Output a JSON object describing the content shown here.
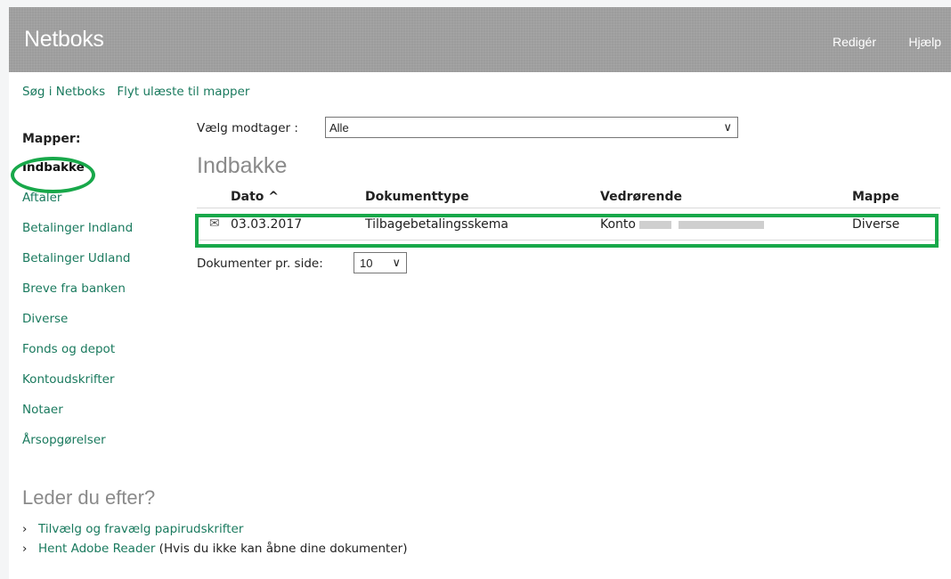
{
  "header": {
    "brand": "Netboks",
    "edit_label": "Redigér",
    "help_label": "Hjælp"
  },
  "toplinks": [
    "Søg i Netboks",
    "Flyt ulæste til mapper"
  ],
  "sidebar": {
    "heading": "Mapper:",
    "items": [
      {
        "label": "Indbakke",
        "active": true
      },
      {
        "label": "Aftaler"
      },
      {
        "label": "Betalinger Indland"
      },
      {
        "label": "Betalinger Udland"
      },
      {
        "label": "Breve fra banken"
      },
      {
        "label": "Diverse"
      },
      {
        "label": "Fonds og depot"
      },
      {
        "label": "Kontoudskrifter"
      },
      {
        "label": "Notaer"
      },
      {
        "label": "Årsopgørelser"
      }
    ]
  },
  "filter": {
    "label": "Vælg modtager :",
    "value": "Alle"
  },
  "main": {
    "title": "Indbakke"
  },
  "table": {
    "columns": [
      "Dato ^",
      "Dokumenttype",
      "Vedrørende",
      "Mappe"
    ],
    "rows": [
      {
        "date": "03.03.2017",
        "type": "Tilbagebetalingsskema",
        "ref": "Konto",
        "folder": "Diverse"
      }
    ]
  },
  "perpage": {
    "label": "Dokumenter pr. side:",
    "value": "10"
  },
  "more": {
    "title": "Leder du efter?",
    "links": [
      {
        "label": "Tilvælg og fravælg papirudskrifter",
        "note": ""
      },
      {
        "label": "Hent Adobe Reader",
        "note": "(Hvis du ikke kan åbne dine dokumenter)"
      }
    ]
  },
  "colors": {
    "accent": "#1a7a5e",
    "highlight": "#18a84a",
    "topbar": "#9c9c9c"
  },
  "icons": {
    "envelope": "envelope-icon",
    "sort": "sort-asc-icon",
    "chevron": "chevron-down-icon"
  }
}
